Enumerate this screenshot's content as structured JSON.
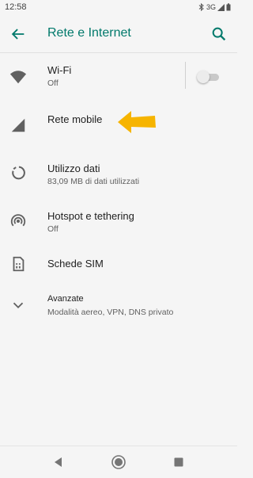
{
  "status": {
    "time": "12:58",
    "network": "3G",
    "icons": [
      "bluetooth-icon",
      "signal-icon",
      "battery-icon"
    ]
  },
  "app_bar": {
    "title": "Rete e Internet",
    "back_icon": "back-arrow-icon",
    "search_icon": "search-icon",
    "accent": "#00796b"
  },
  "items": [
    {
      "icon": "wifi-icon",
      "title": "Wi-Fi",
      "subtitle": "Off",
      "toggle": "off"
    },
    {
      "icon": "mobile-signal-icon",
      "title": "Rete mobile",
      "subtitle": ""
    },
    {
      "icon": "data-usage-icon",
      "title": "Utilizzo dati",
      "subtitle": "83,09 MB di dati utilizzati"
    },
    {
      "icon": "hotspot-icon",
      "title": "Hotspot e tethering",
      "subtitle": "Off"
    },
    {
      "icon": "sim-card-icon",
      "title": "Schede SIM",
      "subtitle": ""
    },
    {
      "icon": "chevron-down-icon",
      "title": "Avanzate",
      "subtitle": "Modalità aereo, VPN, DNS privato"
    }
  ],
  "annotation": {
    "icon": "pointer-arrow-icon",
    "color": "#f6b400"
  },
  "nav": {
    "icons": [
      "back-triangle-icon",
      "home-circle-icon",
      "recents-square-icon"
    ]
  }
}
